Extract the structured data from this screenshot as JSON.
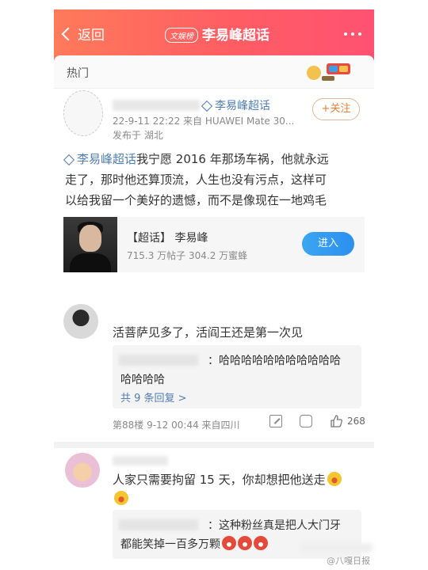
{
  "header": {
    "back_label": "返回",
    "badge": "文娱榜",
    "title": "李易峰超话"
  },
  "hot_tab": {
    "label": "热门"
  },
  "post": {
    "author_topic": "李易峰超话",
    "meta": "22-9-11 22:22  来自 HUAWEI Mate 30...",
    "location": "发布于 湖北",
    "follow_label": "+关注",
    "topic_link": "李易峰超话",
    "body_line1": "我宁愿 2016 年那场车祸，他就永远",
    "body_line2": "走了，那时他还算顶流，人生也没有污点，这样可",
    "body_line3": "以给我留一个美好的遗憾，而不是像现在一地鸡毛"
  },
  "card": {
    "title": "【超话】 李易峰",
    "stats": "715.3 万帖子  304.2 万蜜蜂",
    "enter_label": "进入"
  },
  "comment1": {
    "text": "活菩萨见多了，活阎王还是第一次见",
    "reply_line1": "：哈哈哈哈哈哈哈哈哈哈哈",
    "reply_line2": "哈哈哈哈",
    "reply_more": "共 9 条回复 >",
    "meta": "第88楼  9-12 00:44  来自四川",
    "like_count": "268"
  },
  "comment2": {
    "text": "人家只需要拘留 15 天，你却想把他送走",
    "reply_line1": "：这种粉丝真是把人大门牙",
    "reply_line2": "都能笑掉一百多万颗"
  },
  "watermark": "@八嘎日报",
  "colors": {
    "header_start": "#ff7a5a",
    "header_end": "#ff5272",
    "link_blue": "#507daf",
    "follow_orange": "#e0813a",
    "enter_blue": "#2b8ff0"
  }
}
